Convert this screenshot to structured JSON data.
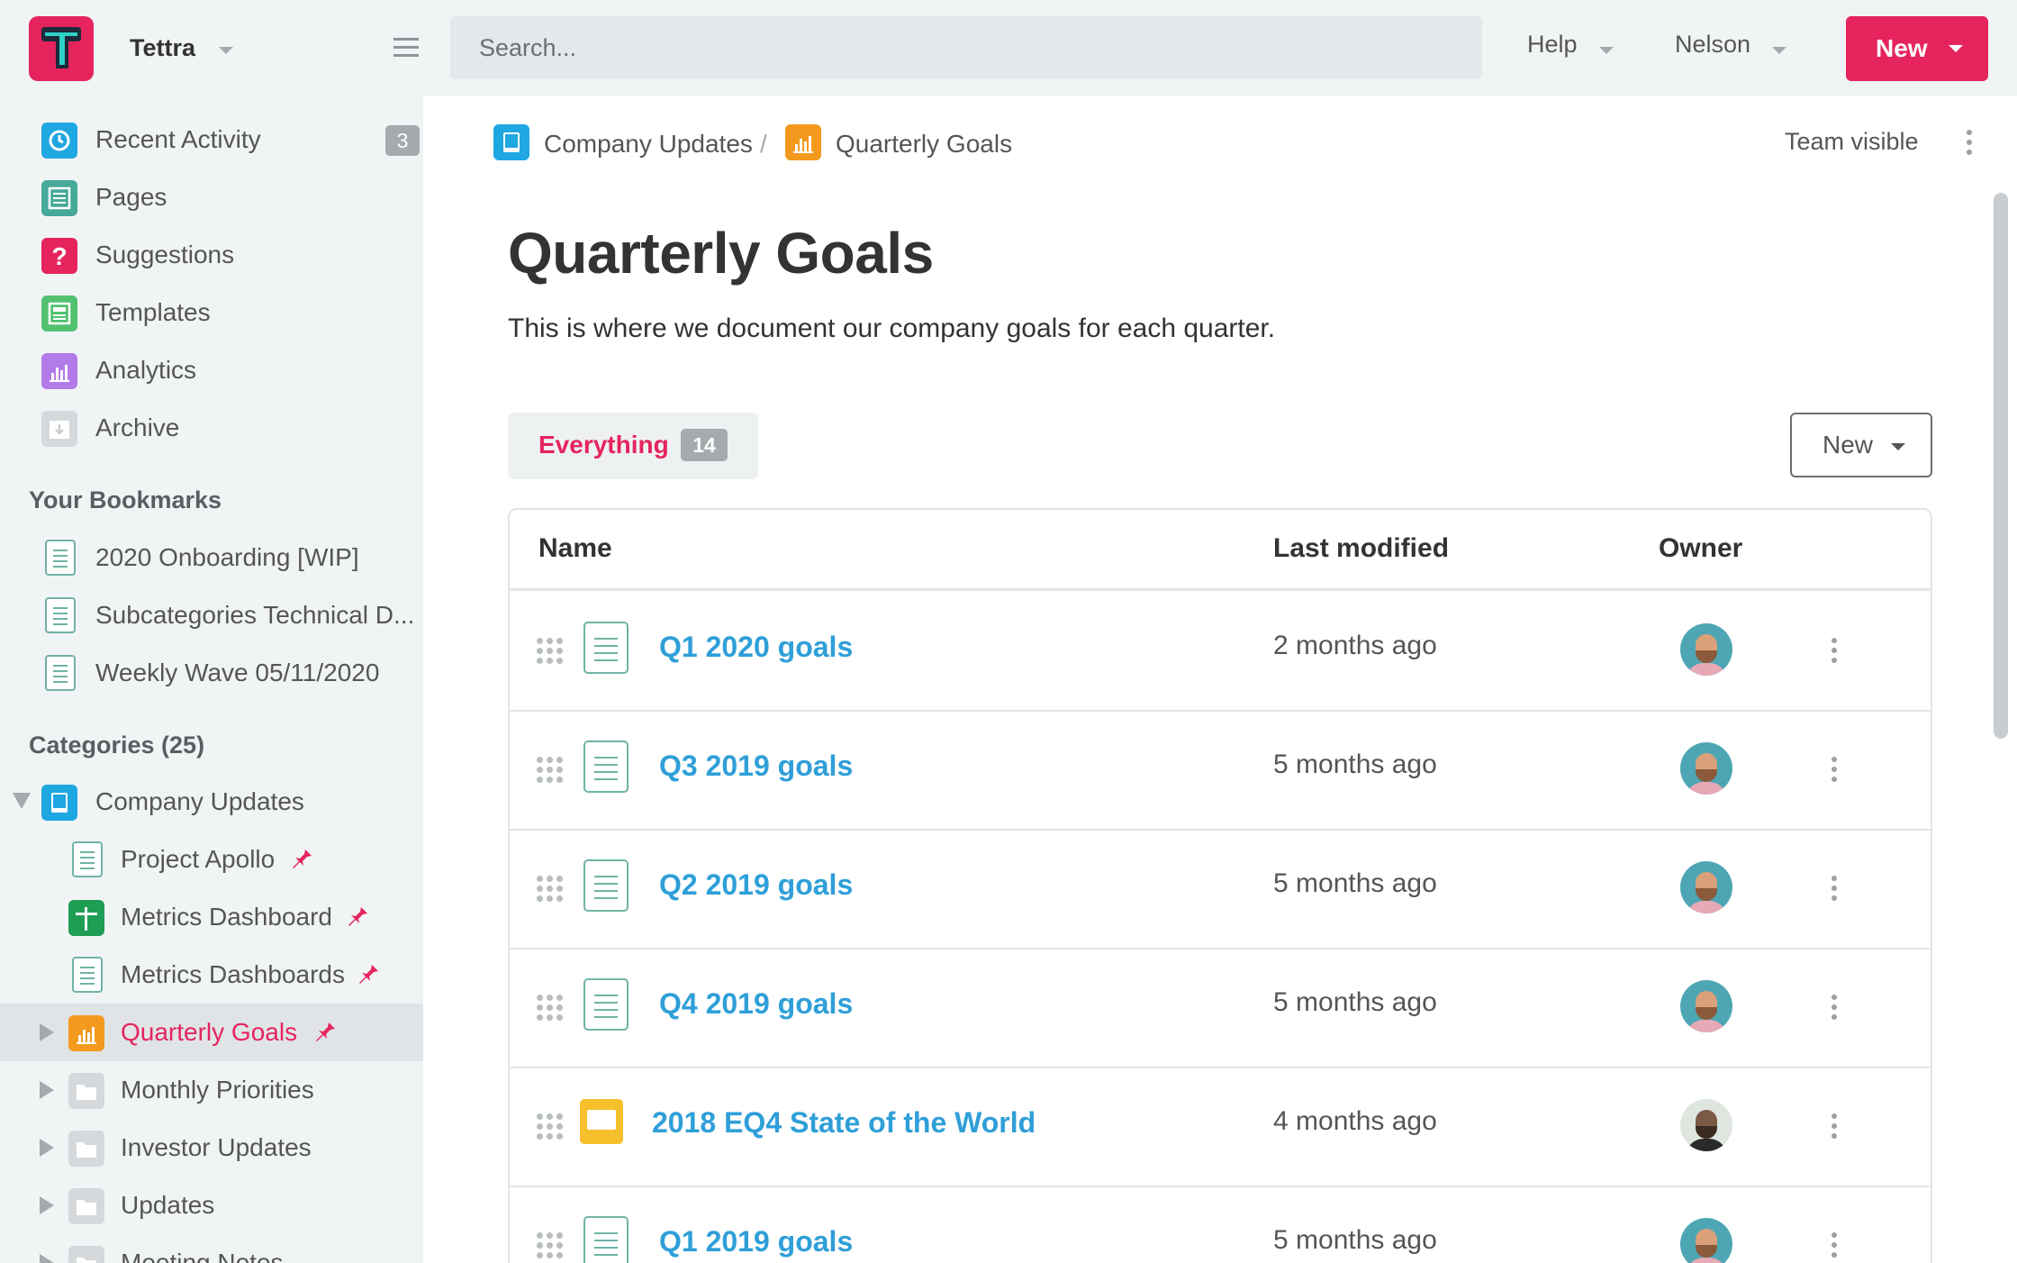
{
  "topbar": {
    "brand": "Tettra",
    "search_placeholder": "Search...",
    "help_label": "Help",
    "user_label": "Nelson",
    "new_label": "New"
  },
  "sidebar": {
    "nav": [
      {
        "label": "Recent Activity",
        "badge": "3",
        "icon": "clock-icon",
        "color": "#1ea7e1"
      },
      {
        "label": "Pages",
        "icon": "pages-icon",
        "color": "#46a99a"
      },
      {
        "label": "Suggestions",
        "icon": "question-icon",
        "color": "#e5245e"
      },
      {
        "label": "Templates",
        "icon": "templates-icon",
        "color": "#52c170"
      },
      {
        "label": "Analytics",
        "icon": "analytics-icon",
        "color": "#b37be8"
      },
      {
        "label": "Archive",
        "icon": "archive-icon",
        "color": "#c9cdd0"
      }
    ],
    "bookmarks_heading": "Your Bookmarks",
    "bookmarks": [
      {
        "label": "2020 Onboarding [WIP]"
      },
      {
        "label": "Subcategories Technical D..."
      },
      {
        "label": "Weekly Wave 05/11/2020"
      }
    ],
    "categories_heading": "Categories (25)",
    "categories": [
      {
        "label": "Company Updates",
        "icon": "book-icon",
        "color": "#1ea7e1"
      },
      {
        "label": "Project Apollo",
        "icon": "doc-icon"
      },
      {
        "label": "Metrics Dashboard",
        "icon": "spreadsheet-icon",
        "color": "#1f9d55"
      },
      {
        "label": "Metrics Dashboards",
        "icon": "doc-icon"
      },
      {
        "label": "Quarterly Goals",
        "icon": "chart-icon",
        "color": "#f39a1e"
      },
      {
        "label": "Monthly Priorities",
        "icon": "folder-icon"
      },
      {
        "label": "Investor Updates",
        "icon": "folder-icon"
      },
      {
        "label": "Updates",
        "icon": "folder-icon"
      },
      {
        "label": "Meeting Notes",
        "icon": "folder-icon"
      }
    ]
  },
  "breadcrumb": {
    "parent": "Company Updates",
    "separator": "/",
    "current": "Quarterly Goals",
    "visibility": "Team visible"
  },
  "page": {
    "title": "Quarterly Goals",
    "description": "This is where we document our company goals for each quarter.",
    "filter_label": "Everything",
    "filter_count": "14",
    "new_label": "New"
  },
  "table": {
    "headers": {
      "name": "Name",
      "modified": "Last modified",
      "owner": "Owner"
    },
    "rows": [
      {
        "name": "Q1 2020 goals",
        "modified": "2 months ago",
        "type": "doc"
      },
      {
        "name": "Q3 2019 goals",
        "modified": "5 months ago",
        "type": "doc"
      },
      {
        "name": "Q2 2019 goals",
        "modified": "5 months ago",
        "type": "doc"
      },
      {
        "name": "Q4 2019 goals",
        "modified": "5 months ago",
        "type": "doc"
      },
      {
        "name": "2018 EQ4 State of the World",
        "modified": "4 months ago",
        "type": "slides"
      },
      {
        "name": "Q1 2019 goals",
        "modified": "5 months ago",
        "type": "doc"
      }
    ]
  },
  "colors": {
    "accent": "#e5245e",
    "link": "#2f9fd8",
    "sidebar_bg": "#f1f4f5"
  }
}
